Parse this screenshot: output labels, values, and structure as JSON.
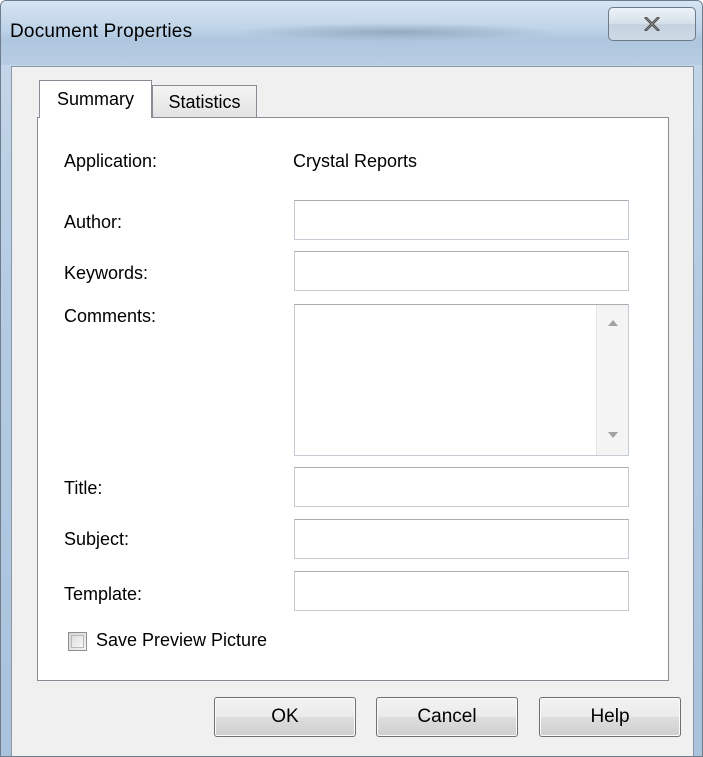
{
  "window": {
    "title": "Document Properties",
    "close_glyph": "✕"
  },
  "tabs": [
    {
      "label": "Summary",
      "active": true
    },
    {
      "label": "Statistics",
      "active": false
    }
  ],
  "summary": {
    "application_label": "Application:",
    "application_value": "Crystal Reports",
    "author_label": "Author:",
    "author_value": "",
    "keywords_label": "Keywords:",
    "keywords_value": "",
    "comments_label": "Comments:",
    "comments_value": "",
    "title_label": "Title:",
    "title_value": "",
    "subject_label": "Subject:",
    "subject_value": "",
    "template_label": "Template:",
    "template_value": "",
    "save_preview_label": "Save Preview Picture",
    "save_preview_checked": false
  },
  "buttons": {
    "ok": "OK",
    "cancel": "Cancel",
    "help": "Help"
  }
}
